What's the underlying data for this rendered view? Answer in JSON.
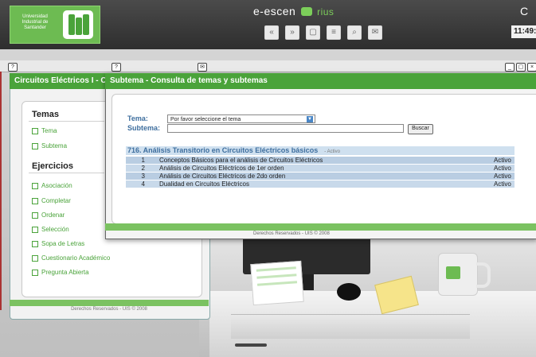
{
  "top": {
    "logo_text": "Universidad Industrial de Santander",
    "app_title_main": "e-escen",
    "app_title_sub": "rius",
    "top_right_char": "C",
    "time": "11:49:",
    "toolbar_icons": [
      "back-icon",
      "forward-icon",
      "page-icon",
      "list-icon",
      "search-icon",
      "mail-icon"
    ]
  },
  "left": {
    "window_title": "Circuitos Eléctricos I - C",
    "temas_title": "Temas",
    "temas_items": [
      "Tema",
      "Subtema"
    ],
    "ejercicios_title": "Ejercicios",
    "ejercicios_items": [
      "Asociación",
      "Completar",
      "Ordenar",
      "Selección",
      "Sopa de Letras",
      "Cuestionario Académico",
      "Pregunta Abierta"
    ],
    "footer": "Derechos Reservados - UIS © 2008"
  },
  "dialog": {
    "title": "Subtema - Consulta de temas y subtemas",
    "tema_label": "Tema:",
    "tema_value": "Por favor seleccione el tema",
    "subtema_label": "Subtema:",
    "subtema_value": "",
    "buscar_label": "Buscar",
    "section_header": "716.  Análisis Transitorio en Circuitos Eléctricos básicos",
    "section_status": "- Activo",
    "rows": [
      {
        "num": "1",
        "name": "Conceptos Básicos para el análisis de Circuitos Eléctricos",
        "state": "Activo"
      },
      {
        "num": "2",
        "name": "Análisis de Circuitos Eléctricos de 1er orden",
        "state": "Activo"
      },
      {
        "num": "3",
        "name": "Análisis de Circuitos Eléctricos de 2do orden",
        "state": "Activo"
      },
      {
        "num": "4",
        "name": "Dualidad en Circuitos Eléctricos",
        "state": "Activo"
      }
    ],
    "footer": "Derechos Reservados - UIS © 2008"
  },
  "colors": {
    "accent_green": "#4aa33a",
    "label_blue": "#3e6e9e"
  }
}
